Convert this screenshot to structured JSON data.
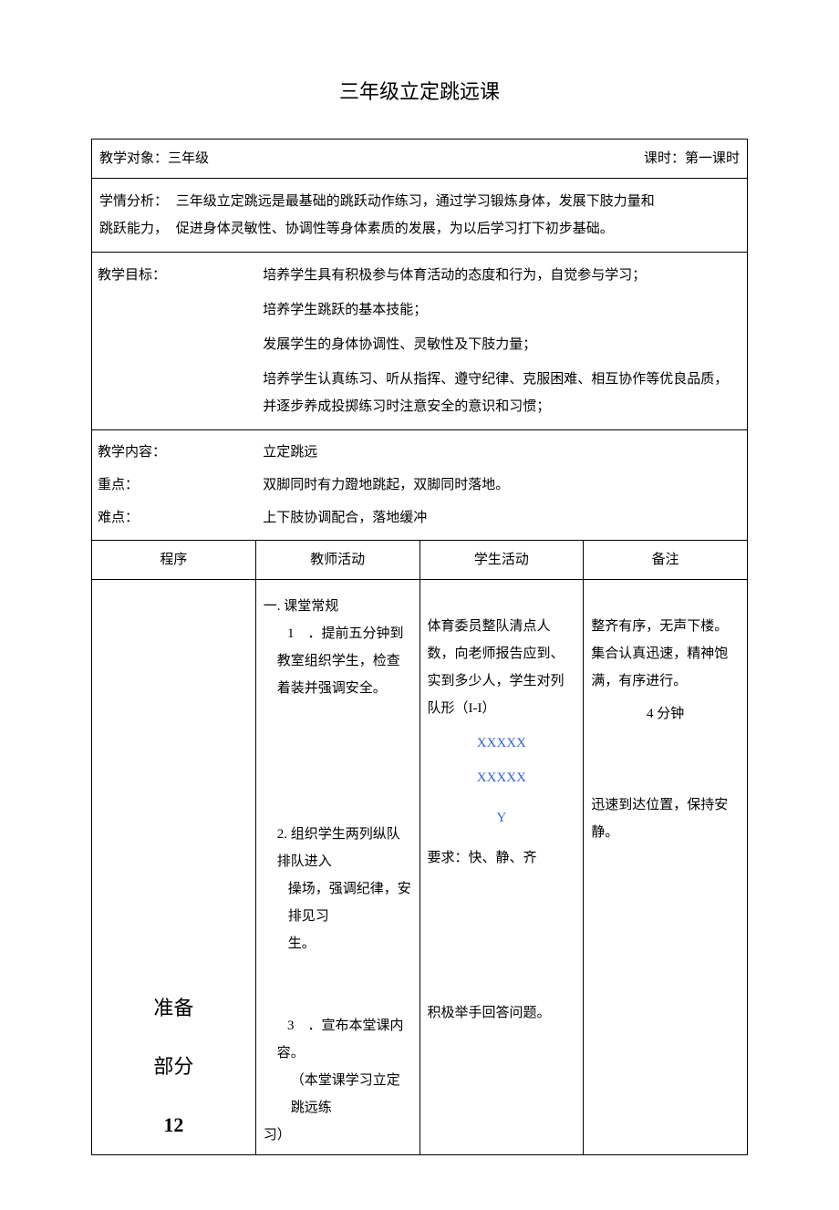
{
  "title": "三年级立定跳远课",
  "meta": {
    "subject_label": "教学对象：三年级",
    "lesson_label": "课时：第一课时"
  },
  "analysis": {
    "label1": "学情分析：",
    "label2": "跳跃能力，",
    "line1": "三年级立定跳远是最基础的跳跃动作练习，通过学习锻炼身体，发展下肢力量和",
    "line2": "促进身体灵敏性、协调性等身体素质的发展，为以后学习打下初步基础。"
  },
  "goals": {
    "label": "教学目标：",
    "g1": "培养学生具有积极参与体育活动的态度和行为，自觉参与学习；",
    "g2": "培养学生跳跃的基本技能；",
    "g3": "发展学生的身体协调性、灵敏性及下肢力量；",
    "g4": "培养学生认真练习、听从指挥、遵守纪律、克服困难、相互协作等优良品质，并逐步养成投掷练习时注意安全的意识和习惯；"
  },
  "content": {
    "label": "教学内容：",
    "text": "立定跳远"
  },
  "focus": {
    "label": "重点：",
    "text": "双脚同时有力蹬地跳起，双脚同时落地。"
  },
  "difficult": {
    "label": "难点：",
    "text": "上下肢协调配合，落地缓冲"
  },
  "headers": {
    "c1": "程序",
    "c2": "教师活动",
    "c3": "学生活动",
    "c4": "备注"
  },
  "prep": {
    "phase_line1": "准备",
    "phase_line2": "部分",
    "phase_num": "12",
    "teacher": {
      "sec_title": "一. 课堂常规",
      "item1_num": "1",
      "item1_text": "．提前五分钟到教室组织学生，检查着装并强调安全。",
      "item2": "2. 组织学生两列纵队排队进入",
      "item2b": "操场，强调纪律，安排见习",
      "item2c": "生。",
      "item3_num": "3",
      "item3_text": "．宣布本堂课内容。",
      "item3_note": "（本堂课学习立定跳远练",
      "item3_note2": "习）"
    },
    "student": {
      "p1": "体育委员整队清点人数，向老师报告应到、实到多少人，学生对列队形（I-I）",
      "form1": "XXXXX",
      "form2": "XXXXX",
      "form3": "Y",
      "req": "要求：快、静、齐",
      "p2": "积极举手回答问题。"
    },
    "note": {
      "n1": "整齐有序，无声下楼。",
      "n2": "集合认真迅速，精神饱满，有序进行。",
      "n3": "4 分钟",
      "n4": "迅速到达位置，保持安静。"
    }
  }
}
